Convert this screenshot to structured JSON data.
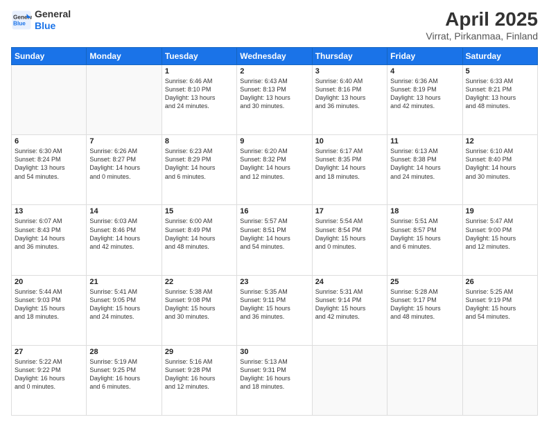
{
  "header": {
    "logo_line1": "General",
    "logo_line2": "Blue",
    "title": "April 2025",
    "subtitle": "Virrat, Pirkanmaa, Finland"
  },
  "weekdays": [
    "Sunday",
    "Monday",
    "Tuesday",
    "Wednesday",
    "Thursday",
    "Friday",
    "Saturday"
  ],
  "weeks": [
    [
      {
        "day": "",
        "info": ""
      },
      {
        "day": "",
        "info": ""
      },
      {
        "day": "1",
        "info": "Sunrise: 6:46 AM\nSunset: 8:10 PM\nDaylight: 13 hours\nand 24 minutes."
      },
      {
        "day": "2",
        "info": "Sunrise: 6:43 AM\nSunset: 8:13 PM\nDaylight: 13 hours\nand 30 minutes."
      },
      {
        "day": "3",
        "info": "Sunrise: 6:40 AM\nSunset: 8:16 PM\nDaylight: 13 hours\nand 36 minutes."
      },
      {
        "day": "4",
        "info": "Sunrise: 6:36 AM\nSunset: 8:19 PM\nDaylight: 13 hours\nand 42 minutes."
      },
      {
        "day": "5",
        "info": "Sunrise: 6:33 AM\nSunset: 8:21 PM\nDaylight: 13 hours\nand 48 minutes."
      }
    ],
    [
      {
        "day": "6",
        "info": "Sunrise: 6:30 AM\nSunset: 8:24 PM\nDaylight: 13 hours\nand 54 minutes."
      },
      {
        "day": "7",
        "info": "Sunrise: 6:26 AM\nSunset: 8:27 PM\nDaylight: 14 hours\nand 0 minutes."
      },
      {
        "day": "8",
        "info": "Sunrise: 6:23 AM\nSunset: 8:29 PM\nDaylight: 14 hours\nand 6 minutes."
      },
      {
        "day": "9",
        "info": "Sunrise: 6:20 AM\nSunset: 8:32 PM\nDaylight: 14 hours\nand 12 minutes."
      },
      {
        "day": "10",
        "info": "Sunrise: 6:17 AM\nSunset: 8:35 PM\nDaylight: 14 hours\nand 18 minutes."
      },
      {
        "day": "11",
        "info": "Sunrise: 6:13 AM\nSunset: 8:38 PM\nDaylight: 14 hours\nand 24 minutes."
      },
      {
        "day": "12",
        "info": "Sunrise: 6:10 AM\nSunset: 8:40 PM\nDaylight: 14 hours\nand 30 minutes."
      }
    ],
    [
      {
        "day": "13",
        "info": "Sunrise: 6:07 AM\nSunset: 8:43 PM\nDaylight: 14 hours\nand 36 minutes."
      },
      {
        "day": "14",
        "info": "Sunrise: 6:03 AM\nSunset: 8:46 PM\nDaylight: 14 hours\nand 42 minutes."
      },
      {
        "day": "15",
        "info": "Sunrise: 6:00 AM\nSunset: 8:49 PM\nDaylight: 14 hours\nand 48 minutes."
      },
      {
        "day": "16",
        "info": "Sunrise: 5:57 AM\nSunset: 8:51 PM\nDaylight: 14 hours\nand 54 minutes."
      },
      {
        "day": "17",
        "info": "Sunrise: 5:54 AM\nSunset: 8:54 PM\nDaylight: 15 hours\nand 0 minutes."
      },
      {
        "day": "18",
        "info": "Sunrise: 5:51 AM\nSunset: 8:57 PM\nDaylight: 15 hours\nand 6 minutes."
      },
      {
        "day": "19",
        "info": "Sunrise: 5:47 AM\nSunset: 9:00 PM\nDaylight: 15 hours\nand 12 minutes."
      }
    ],
    [
      {
        "day": "20",
        "info": "Sunrise: 5:44 AM\nSunset: 9:03 PM\nDaylight: 15 hours\nand 18 minutes."
      },
      {
        "day": "21",
        "info": "Sunrise: 5:41 AM\nSunset: 9:05 PM\nDaylight: 15 hours\nand 24 minutes."
      },
      {
        "day": "22",
        "info": "Sunrise: 5:38 AM\nSunset: 9:08 PM\nDaylight: 15 hours\nand 30 minutes."
      },
      {
        "day": "23",
        "info": "Sunrise: 5:35 AM\nSunset: 9:11 PM\nDaylight: 15 hours\nand 36 minutes."
      },
      {
        "day": "24",
        "info": "Sunrise: 5:31 AM\nSunset: 9:14 PM\nDaylight: 15 hours\nand 42 minutes."
      },
      {
        "day": "25",
        "info": "Sunrise: 5:28 AM\nSunset: 9:17 PM\nDaylight: 15 hours\nand 48 minutes."
      },
      {
        "day": "26",
        "info": "Sunrise: 5:25 AM\nSunset: 9:19 PM\nDaylight: 15 hours\nand 54 minutes."
      }
    ],
    [
      {
        "day": "27",
        "info": "Sunrise: 5:22 AM\nSunset: 9:22 PM\nDaylight: 16 hours\nand 0 minutes."
      },
      {
        "day": "28",
        "info": "Sunrise: 5:19 AM\nSunset: 9:25 PM\nDaylight: 16 hours\nand 6 minutes."
      },
      {
        "day": "29",
        "info": "Sunrise: 5:16 AM\nSunset: 9:28 PM\nDaylight: 16 hours\nand 12 minutes."
      },
      {
        "day": "30",
        "info": "Sunrise: 5:13 AM\nSunset: 9:31 PM\nDaylight: 16 hours\nand 18 minutes."
      },
      {
        "day": "",
        "info": ""
      },
      {
        "day": "",
        "info": ""
      },
      {
        "day": "",
        "info": ""
      }
    ]
  ]
}
